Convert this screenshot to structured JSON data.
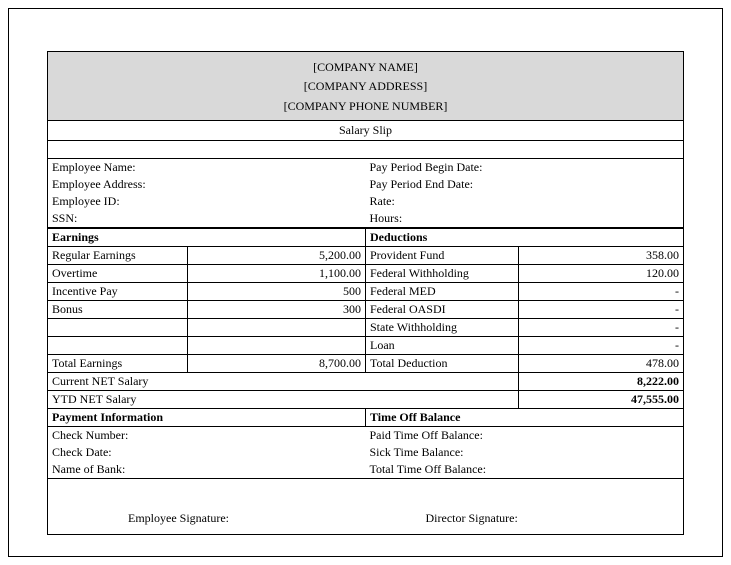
{
  "header": {
    "company_name": "[COMPANY NAME]",
    "company_address": "[COMPANY ADDRESS]",
    "company_phone": "[COMPANY PHONE NUMBER]",
    "title": "Salary Slip"
  },
  "employee": {
    "name_label": "Employee Name:",
    "address_label": "Employee Address:",
    "id_label": "Employee ID:",
    "ssn_label": "SSN:",
    "name": "",
    "address": "",
    "id": "",
    "ssn": ""
  },
  "period": {
    "begin_label": "Pay Period Begin Date:",
    "end_label": "Pay Period End Date:",
    "rate_label": "Rate:",
    "hours_label": "Hours:",
    "begin": "",
    "end": "",
    "rate": "",
    "hours": ""
  },
  "earnings": {
    "heading": "Earnings",
    "rows": [
      {
        "label": "Regular Earnings",
        "value": "5,200.00"
      },
      {
        "label": "Overtime",
        "value": "1,100.00"
      },
      {
        "label": "Incentive Pay",
        "value": "500"
      },
      {
        "label": "Bonus",
        "value": "300"
      }
    ],
    "total_label": "Total Earnings",
    "total_value": "8,700.00"
  },
  "deductions": {
    "heading": "Deductions",
    "rows": [
      {
        "label": "Provident Fund",
        "value": "358.00"
      },
      {
        "label": "Federal Withholding",
        "value": "120.00"
      },
      {
        "label": "Federal MED",
        "value": "-"
      },
      {
        "label": "Federal OASDI",
        "value": "-"
      },
      {
        "label": "State Withholding",
        "value": "-"
      },
      {
        "label": "Loan",
        "value": "-"
      }
    ],
    "total_label": "Total Deduction",
    "total_value": "478.00"
  },
  "net": {
    "current_label": "Current NET Salary",
    "current_value": "8,222.00",
    "ytd_label": "YTD NET Salary",
    "ytd_value": "47,555.00"
  },
  "payment": {
    "heading": "Payment Information",
    "check_num_label": "Check Number:",
    "check_date_label": "Check Date:",
    "bank_label": "Name of Bank:"
  },
  "timeoff": {
    "heading": "Time Off Balance",
    "paid_label": "Paid Time Off Balance:",
    "sick_label": "Sick Time Balance:",
    "total_label": "Total Time Off Balance:"
  },
  "signatures": {
    "employee": "Employee Signature:",
    "director": "Director  Signature:"
  }
}
